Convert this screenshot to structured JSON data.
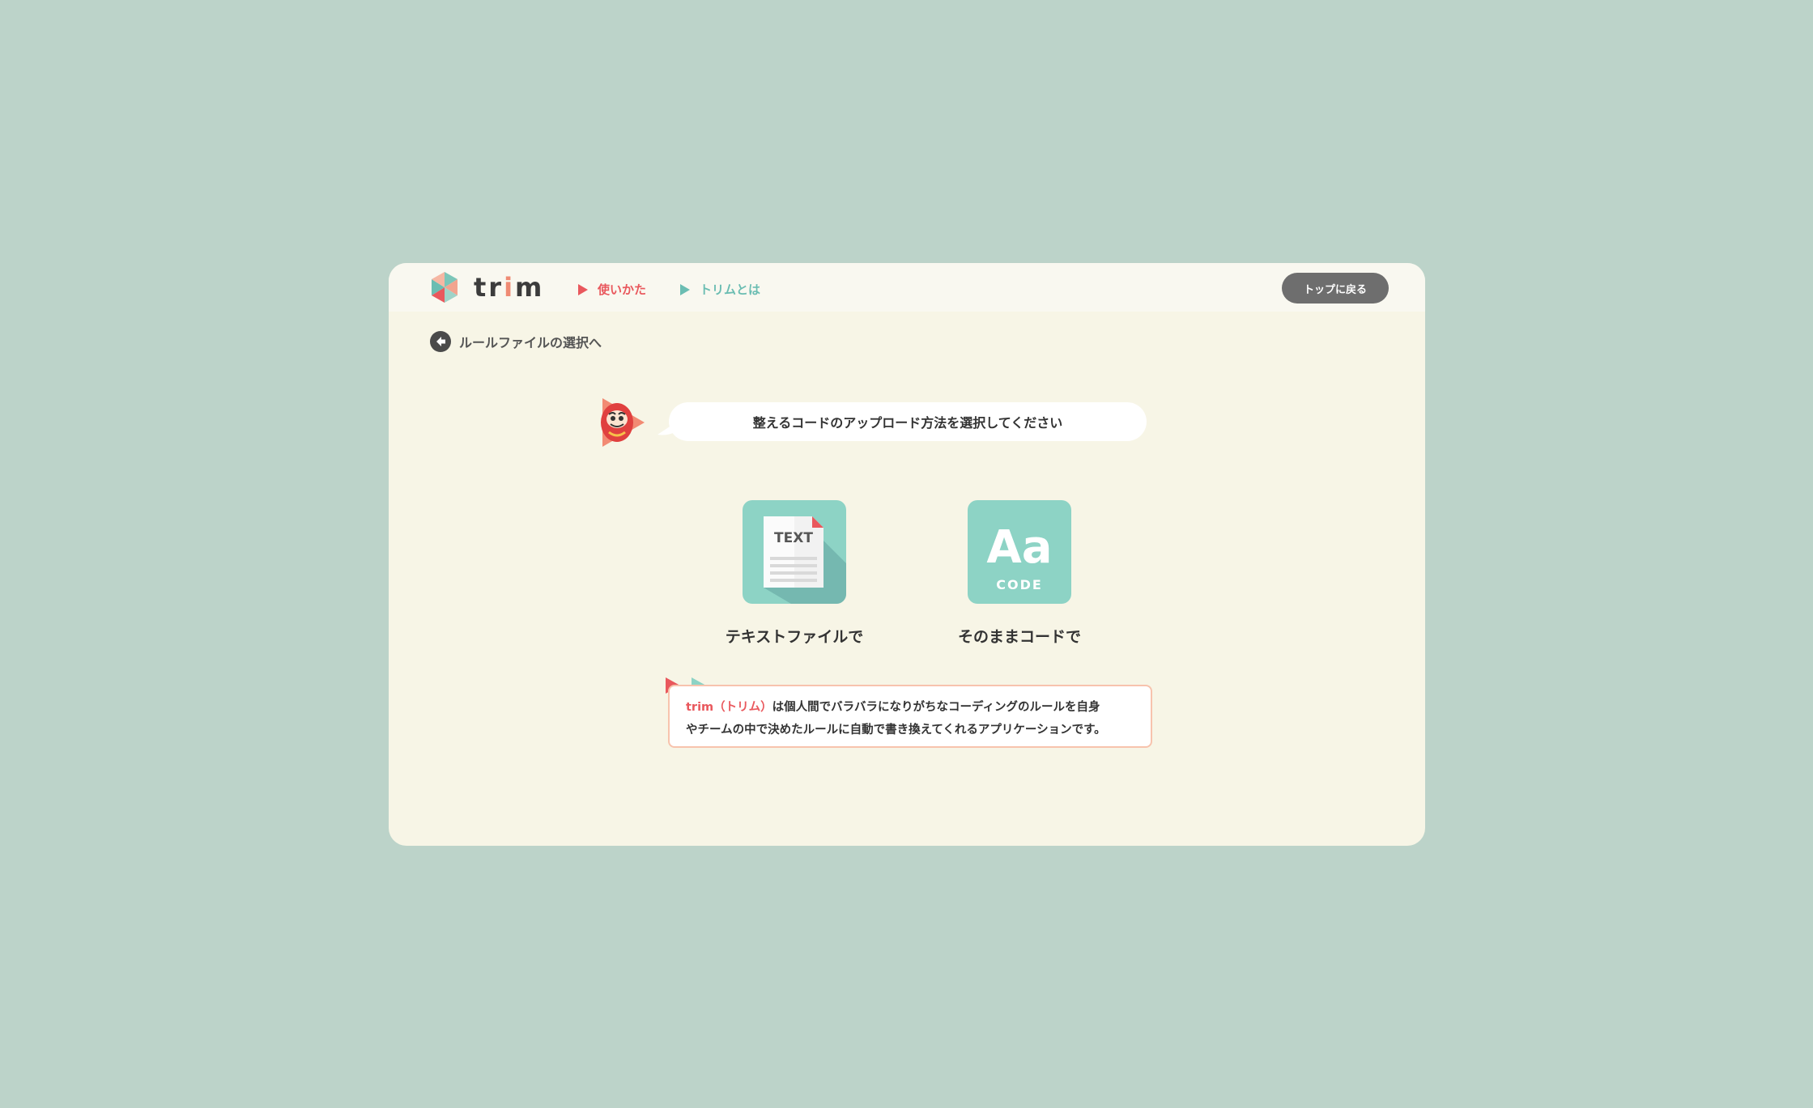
{
  "header": {
    "logo_text": "trim",
    "nav": [
      {
        "label": "使いかた"
      },
      {
        "label": "トリムとは"
      }
    ],
    "top_button": "トップに戻る"
  },
  "back_link": "ルールファイルの選択へ",
  "prompt": "整えるコードのアップロード方法を選択してください",
  "options": [
    {
      "label": "テキストファイルで",
      "icon_text": "TEXT"
    },
    {
      "label": "そのままコードで",
      "icon_big": "Aa",
      "icon_small": "CODE"
    }
  ],
  "info": {
    "highlight": "trim（トリム）",
    "line1_rest": "は個人間でバラバラになりがちなコーディングのルールを自身",
    "line2": "やチームの中で決めたルールに自動で書き換えてくれるアプリケーションです。"
  },
  "colors": {
    "background": "#bcd3c9",
    "card": "#f7f5e6",
    "accent_red": "#e9585d",
    "accent_teal": "#6bbdb2",
    "tile": "#8dd3c5"
  }
}
